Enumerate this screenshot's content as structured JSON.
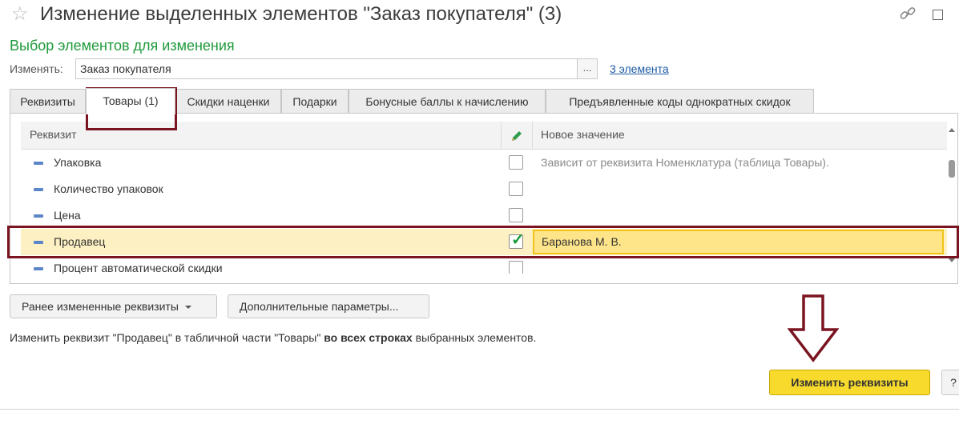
{
  "window": {
    "title": "Изменение выделенных элементов \"Заказ покупателя\" (3)"
  },
  "section_title": "Выбор элементов для изменения",
  "change": {
    "label": "Изменять:",
    "value": "Заказ покупателя",
    "select_button": "...",
    "count_link": "3 элемента"
  },
  "tabs": [
    {
      "label": "Реквизиты",
      "active": false
    },
    {
      "label": "Товары (1)",
      "active": true
    },
    {
      "label": "Скидки наценки",
      "active": false
    },
    {
      "label": "Подарки",
      "active": false
    },
    {
      "label": "Бонусные баллы к начислению",
      "active": false
    },
    {
      "label": "Предъявленные коды однократных скидок",
      "active": false
    }
  ],
  "grid": {
    "col_attribute": "Реквизит",
    "col_edit_icon": "pencil-icon",
    "col_new_value": "Новое значение",
    "rows": [
      {
        "label": "Упаковка",
        "checked": false,
        "value": "Зависит от реквизита Номенклатура (таблица Товары)."
      },
      {
        "label": "Количество упаковок",
        "checked": false,
        "value": ""
      },
      {
        "label": "Цена",
        "checked": false,
        "value": ""
      },
      {
        "label": "Продавец",
        "checked": true,
        "value": "Баранова М. В.",
        "selected": true
      },
      {
        "label": "Процент автоматической скидки",
        "checked": false,
        "value": ""
      }
    ]
  },
  "buttons": {
    "previous": "Ранее измененные реквизиты",
    "more_params": "Дополнительные параметры...",
    "apply": "Изменить реквизиты",
    "help": "?"
  },
  "hint": {
    "part1": "Изменить реквизит \"Продавец\" в табличной части \"Товары\" ",
    "bold": "во всех строках",
    "part2": " выбранных элементов."
  },
  "colors": {
    "accent_green": "#1f9a3a",
    "highlight_frame": "#7a1420",
    "selected_row": "#fdf0c2",
    "apply_button": "#f7da2c"
  }
}
